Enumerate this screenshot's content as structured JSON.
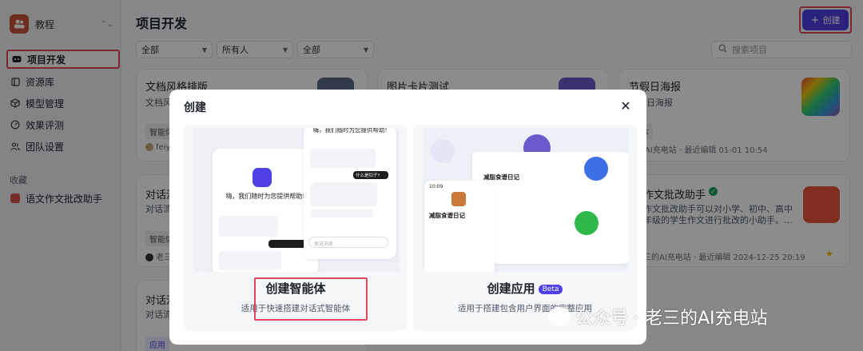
{
  "sidebar": {
    "workspace": "教程",
    "nav": [
      {
        "label": "项目开发",
        "active": true
      },
      {
        "label": "资源库"
      },
      {
        "label": "模型管理"
      },
      {
        "label": "效果评测"
      },
      {
        "label": "团队设置"
      }
    ],
    "favorites_label": "收藏",
    "favorites": [
      {
        "label": "语文作文批改助手"
      }
    ]
  },
  "main": {
    "title": "项目开发",
    "create_button": "创建",
    "filters": [
      "全部",
      "所有人",
      "全部"
    ],
    "search_placeholder": "搜索项目",
    "cards": [
      {
        "title": "文档风格排版",
        "sub": "文档风",
        "tag": "智能体",
        "owner": "feiy"
      },
      {
        "title": "图片卡片测试",
        "sub": "",
        "tag": "",
        "owner": ""
      },
      {
        "title": "节假日海报",
        "sub": "节假日海报",
        "tag": "能体",
        "meta": "三的AI充电站 · 最近编辑 01-01 10:54"
      },
      {
        "title": "对话流",
        "sub": "对话流",
        "tag": "智能体",
        "owner": "老三"
      },
      {
        "title": "作文批改助手",
        "sub": "作文批改助手可以对小学、初中、高中",
        "sub2": "年级的学生作文进行批改的小助手。…",
        "meta": "三的AI充电站 · 最近编辑 2024-12-25 20:19"
      },
      {
        "title": "对话流",
        "sub": "对话流",
        "tag": "应用"
      }
    ]
  },
  "modal": {
    "title": "创建",
    "options": [
      {
        "title": "创建智能体",
        "desc": "适用于快速搭建对话式智能体",
        "badge": ""
      },
      {
        "title": "创建应用",
        "desc": "适用于搭建包含用户界面的完整应用",
        "badge": "Beta"
      }
    ],
    "agent_preview": {
      "greeting": "嗨，我们随时为您提供帮助!",
      "greeting_top": "嗨，我们随时为您提供帮助!",
      "user_msg": "什么是扣子?",
      "input_placeholder": "发送消息"
    },
    "app_preview": {
      "title": "减脂食谱日记",
      "time": "10:09"
    }
  },
  "watermark": "公众号 · 老三的AI充电站",
  "colors": {
    "accent": "#4e40e5",
    "highlight": "#e4455f"
  }
}
